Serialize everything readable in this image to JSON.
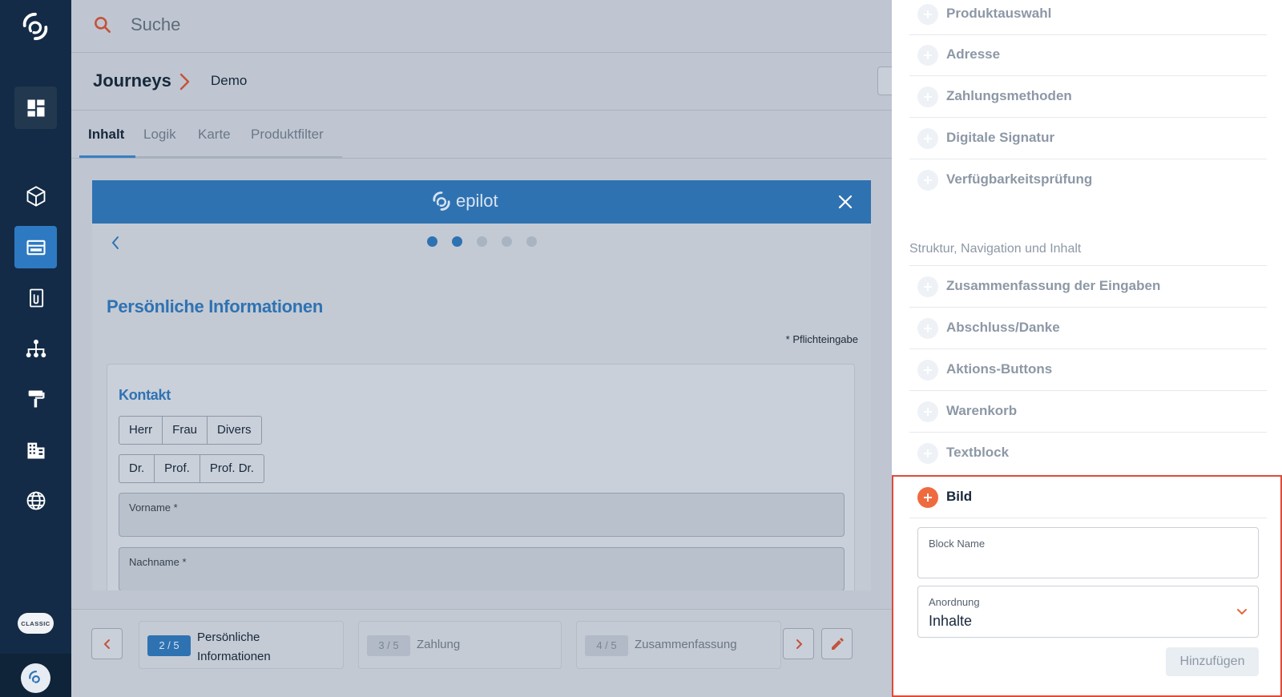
{
  "search": {
    "placeholder": "Suche"
  },
  "breadcrumb": {
    "root": "Journeys",
    "current": "Demo"
  },
  "tabs": [
    "Inhalt",
    "Logik",
    "Karte",
    "Produktfilter"
  ],
  "preview": {
    "brand": "epilot",
    "title": "Persönliche Informationen",
    "required_note": "* Pflichteingabe",
    "card_title": "Kontakt",
    "salutations": [
      "Herr",
      "Frau",
      "Divers"
    ],
    "titles": [
      "Dr.",
      "Prof.",
      "Prof. Dr."
    ],
    "first_name_label": "Vorname *",
    "last_name_label": "Nachname *",
    "dots_total": 5,
    "dots_active": 2
  },
  "steps": [
    {
      "badge": "2 / 5",
      "label": "Persönliche Informationen",
      "active": true
    },
    {
      "badge": "3 / 5",
      "label": "Zahlung",
      "active": false
    },
    {
      "badge": "4 / 5",
      "label": "Zusammenfassung",
      "active": false
    }
  ],
  "sidebar": {
    "classic_label": "CLASSIC",
    "avatar_text": "epilot"
  },
  "panel": {
    "items_top": [
      "Produktauswahl",
      "Adresse",
      "Zahlungsmethoden",
      "Digitale Signatur",
      "Verfügbarkeitsprüfung"
    ],
    "section_title": "Struktur, Navigation und Inhalt",
    "items_structure": [
      "Zusammenfassung der Eingaben",
      "Abschluss/Danke",
      "Aktions-Buttons",
      "Warenkorb",
      "Textblock"
    ],
    "selected_item": "Bild",
    "block_name_label": "Block Name",
    "block_name_value": "",
    "arrangement_label": "Anordnung",
    "arrangement_value": "Inhalte",
    "add_button": "Hinzufügen"
  },
  "colors": {
    "accent": "#2f72b2",
    "sidebar": "#132b46",
    "highlight": "#e04a3a",
    "orange": "#ef6a3f"
  }
}
